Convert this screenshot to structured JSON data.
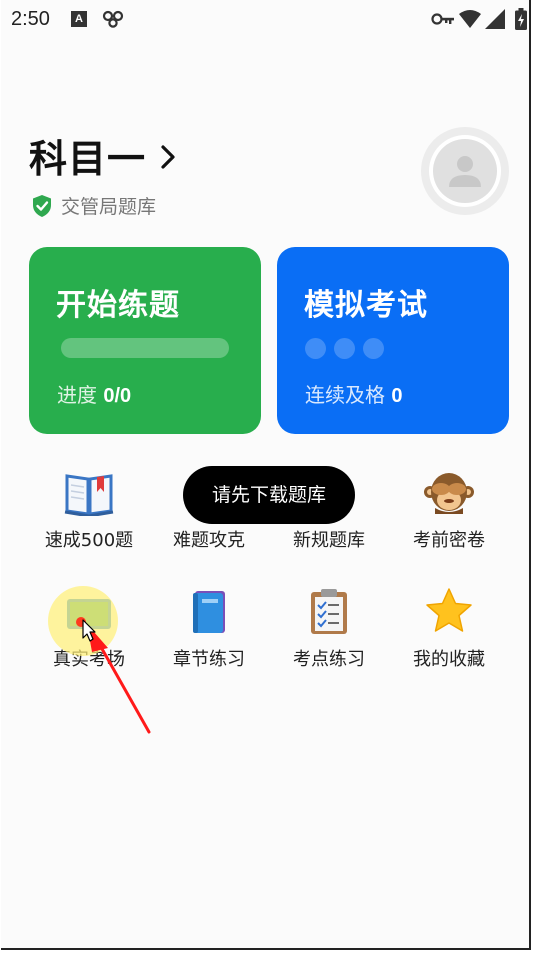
{
  "status_bar": {
    "time": "2:50",
    "left_icons": [
      "app-a-icon",
      "infinity-icon"
    ],
    "right_icons": [
      "key-icon",
      "wifi-icon",
      "signal-icon",
      "battery-icon"
    ]
  },
  "header": {
    "subject": "科目一",
    "bank_label": "交管局题库"
  },
  "cards": {
    "practice": {
      "title": "开始练题",
      "progress_label": "进度",
      "progress_value": "0/0",
      "progress_fraction": 0
    },
    "exam": {
      "title": "模拟考试",
      "streak_label": "连续及格",
      "streak_value": "0",
      "streak_dots": 3
    }
  },
  "grid": {
    "items": [
      {
        "label": "速成500题",
        "icon": "open-book-icon"
      },
      {
        "label": "难题攻克",
        "icon": "hard-question-icon"
      },
      {
        "label": "新规题库",
        "icon": "new-rules-icon"
      },
      {
        "label": "考前密卷",
        "icon": "see-no-evil-monkey-icon"
      },
      {
        "label": "真实考场",
        "icon": "exam-room-icon"
      },
      {
        "label": "章节练习",
        "icon": "blue-book-icon"
      },
      {
        "label": "考点练习",
        "icon": "clipboard-icon"
      },
      {
        "label": "我的收藏",
        "icon": "star-icon"
      }
    ]
  },
  "toast": {
    "text": "请先下载题库"
  },
  "colors": {
    "practice_card": "#28ae4d",
    "exam_card": "#0a6ef5",
    "shield": "#2fa84f",
    "toast_bg": "#000000"
  }
}
